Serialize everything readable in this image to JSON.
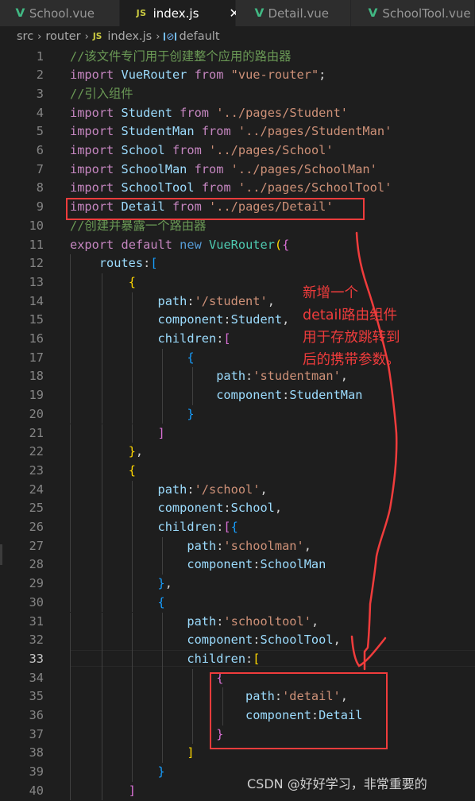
{
  "tabs": [
    {
      "label": "School.vue",
      "icon": "vue-icon",
      "active": false
    },
    {
      "label": "index.js",
      "icon": "js-icon",
      "active": true,
      "close": "✕"
    },
    {
      "label": "Detail.vue",
      "icon": "vue-icon",
      "active": false
    },
    {
      "label": "SchoolTool.vue",
      "icon": "vue-icon",
      "active": false
    }
  ],
  "icons": {
    "vue": "V",
    "js": "JS",
    "symbol": "⊘"
  },
  "breadcrumb": {
    "items": [
      "src",
      "router",
      "index.js",
      "default"
    ],
    "separator": "›"
  },
  "editor": {
    "current_line": 33,
    "lines": [
      [
        [
          "c-cmt",
          "//该文件专门用于创建整个应用的路由器"
        ]
      ],
      [
        [
          "c-kw",
          "import"
        ],
        [
          "c-pun",
          " "
        ],
        [
          "c-id",
          "VueRouter"
        ],
        [
          "c-pun",
          " "
        ],
        [
          "c-kw",
          "from"
        ],
        [
          "c-pun",
          " "
        ],
        [
          "c-str",
          "\"vue-router\""
        ],
        [
          "c-pun",
          ";"
        ]
      ],
      [
        [
          "c-cmt",
          "//引入组件"
        ]
      ],
      [
        [
          "c-kw",
          "import"
        ],
        [
          "c-pun",
          " "
        ],
        [
          "c-id",
          "Student"
        ],
        [
          "c-pun",
          " "
        ],
        [
          "c-kw",
          "from"
        ],
        [
          "c-pun",
          " "
        ],
        [
          "c-str",
          "'../pages/Student'"
        ]
      ],
      [
        [
          "c-kw",
          "import"
        ],
        [
          "c-pun",
          " "
        ],
        [
          "c-id",
          "StudentMan"
        ],
        [
          "c-pun",
          " "
        ],
        [
          "c-kw",
          "from"
        ],
        [
          "c-pun",
          " "
        ],
        [
          "c-str",
          "'../pages/StudentMan'"
        ]
      ],
      [
        [
          "c-kw",
          "import"
        ],
        [
          "c-pun",
          " "
        ],
        [
          "c-id",
          "School"
        ],
        [
          "c-pun",
          " "
        ],
        [
          "c-kw",
          "from"
        ],
        [
          "c-pun",
          " "
        ],
        [
          "c-str",
          "'../pages/School'"
        ]
      ],
      [
        [
          "c-kw",
          "import"
        ],
        [
          "c-pun",
          " "
        ],
        [
          "c-id",
          "SchoolMan"
        ],
        [
          "c-pun",
          " "
        ],
        [
          "c-kw",
          "from"
        ],
        [
          "c-pun",
          " "
        ],
        [
          "c-str",
          "'../pages/SchoolMan'"
        ]
      ],
      [
        [
          "c-kw",
          "import"
        ],
        [
          "c-pun",
          " "
        ],
        [
          "c-id",
          "SchoolTool"
        ],
        [
          "c-pun",
          " "
        ],
        [
          "c-kw",
          "from"
        ],
        [
          "c-pun",
          " "
        ],
        [
          "c-str",
          "'../pages/SchoolTool'"
        ]
      ],
      [
        [
          "c-kw",
          "import"
        ],
        [
          "c-pun",
          " "
        ],
        [
          "c-id",
          "Detail"
        ],
        [
          "c-pun",
          " "
        ],
        [
          "c-kw",
          "from"
        ],
        [
          "c-pun",
          " "
        ],
        [
          "c-str",
          "'../pages/Detail'"
        ]
      ],
      [
        [
          "c-cmt",
          "//创建并暴露一个路由器"
        ]
      ],
      [
        [
          "c-kw",
          "export"
        ],
        [
          "c-pun",
          " "
        ],
        [
          "c-kw",
          "default"
        ],
        [
          "c-pun",
          " "
        ],
        [
          "c-kw2",
          "new"
        ],
        [
          "c-pun",
          " "
        ],
        [
          "c-cls",
          "VueRouter"
        ],
        [
          "b-y",
          "("
        ],
        [
          "b-p",
          "{"
        ]
      ],
      [
        [
          "c-pun",
          "    "
        ],
        [
          "c-id",
          "routes"
        ],
        [
          "c-pun",
          ":"
        ],
        [
          "b-b",
          "["
        ]
      ],
      [
        [
          "c-pun",
          "        "
        ],
        [
          "b-y",
          "{"
        ]
      ],
      [
        [
          "c-pun",
          "            "
        ],
        [
          "c-id",
          "path"
        ],
        [
          "c-pun",
          ":"
        ],
        [
          "c-str",
          "'/student'"
        ],
        [
          "c-pun",
          ","
        ]
      ],
      [
        [
          "c-pun",
          "            "
        ],
        [
          "c-id",
          "component"
        ],
        [
          "c-pun",
          ":"
        ],
        [
          "c-id",
          "Student"
        ],
        [
          "c-pun",
          ","
        ]
      ],
      [
        [
          "c-pun",
          "            "
        ],
        [
          "c-id",
          "children"
        ],
        [
          "c-pun",
          ":"
        ],
        [
          "b-p",
          "["
        ]
      ],
      [
        [
          "c-pun",
          "                "
        ],
        [
          "b-b",
          "{"
        ]
      ],
      [
        [
          "c-pun",
          "                    "
        ],
        [
          "c-id",
          "path"
        ],
        [
          "c-pun",
          ":"
        ],
        [
          "c-str",
          "'studentman'"
        ],
        [
          "c-pun",
          ","
        ]
      ],
      [
        [
          "c-pun",
          "                    "
        ],
        [
          "c-id",
          "component"
        ],
        [
          "c-pun",
          ":"
        ],
        [
          "c-id",
          "StudentMan"
        ]
      ],
      [
        [
          "c-pun",
          "                "
        ],
        [
          "b-b",
          "}"
        ]
      ],
      [
        [
          "c-pun",
          "            "
        ],
        [
          "b-p",
          "]"
        ]
      ],
      [
        [
          "c-pun",
          "        "
        ],
        [
          "b-y",
          "}"
        ],
        [
          "c-pun",
          ","
        ]
      ],
      [
        [
          "c-pun",
          "        "
        ],
        [
          "b-y",
          "{"
        ]
      ],
      [
        [
          "c-pun",
          "            "
        ],
        [
          "c-id",
          "path"
        ],
        [
          "c-pun",
          ":"
        ],
        [
          "c-str",
          "'/school'"
        ],
        [
          "c-pun",
          ","
        ]
      ],
      [
        [
          "c-pun",
          "            "
        ],
        [
          "c-id",
          "component"
        ],
        [
          "c-pun",
          ":"
        ],
        [
          "c-id",
          "School"
        ],
        [
          "c-pun",
          ","
        ]
      ],
      [
        [
          "c-pun",
          "            "
        ],
        [
          "c-id",
          "children"
        ],
        [
          "c-pun",
          ":"
        ],
        [
          "b-p",
          "["
        ],
        [
          "b-b",
          "{"
        ]
      ],
      [
        [
          "c-pun",
          "                "
        ],
        [
          "c-id",
          "path"
        ],
        [
          "c-pun",
          ":"
        ],
        [
          "c-str",
          "'schoolman'"
        ],
        [
          "c-pun",
          ","
        ]
      ],
      [
        [
          "c-pun",
          "                "
        ],
        [
          "c-id",
          "component"
        ],
        [
          "c-pun",
          ":"
        ],
        [
          "c-id",
          "SchoolMan"
        ]
      ],
      [
        [
          "c-pun",
          "            "
        ],
        [
          "b-b",
          "}"
        ],
        [
          "c-pun",
          ","
        ]
      ],
      [
        [
          "c-pun",
          "            "
        ],
        [
          "b-b",
          "{"
        ]
      ],
      [
        [
          "c-pun",
          "                "
        ],
        [
          "c-id",
          "path"
        ],
        [
          "c-pun",
          ":"
        ],
        [
          "c-str",
          "'schooltool'"
        ],
        [
          "c-pun",
          ","
        ]
      ],
      [
        [
          "c-pun",
          "                "
        ],
        [
          "c-id",
          "component"
        ],
        [
          "c-pun",
          ":"
        ],
        [
          "c-id",
          "SchoolTool"
        ],
        [
          "c-pun",
          ","
        ]
      ],
      [
        [
          "c-pun",
          "                "
        ],
        [
          "c-id",
          "children"
        ],
        [
          "c-pun",
          ":"
        ],
        [
          "b-y",
          "["
        ]
      ],
      [
        [
          "c-pun",
          "                    "
        ],
        [
          "b-p",
          "{"
        ]
      ],
      [
        [
          "c-pun",
          "                        "
        ],
        [
          "c-id",
          "path"
        ],
        [
          "c-pun",
          ":"
        ],
        [
          "c-str",
          "'detail'"
        ],
        [
          "c-pun",
          ","
        ]
      ],
      [
        [
          "c-pun",
          "                        "
        ],
        [
          "c-id",
          "component"
        ],
        [
          "c-pun",
          ":"
        ],
        [
          "c-id",
          "Detail"
        ]
      ],
      [
        [
          "c-pun",
          "                    "
        ],
        [
          "b-p",
          "}"
        ]
      ],
      [
        [
          "c-pun",
          "                "
        ],
        [
          "b-y",
          "]"
        ]
      ],
      [
        [
          "c-pun",
          "            "
        ],
        [
          "b-b",
          "}"
        ]
      ],
      [
        [
          "c-pun",
          "        "
        ],
        [
          "b-p",
          "]"
        ]
      ]
    ]
  },
  "annotations": {
    "note_lines": [
      "新增一个",
      "detail路由组件",
      "用于存放跳转到",
      "后的携带参数。"
    ],
    "color": "#f03c3c",
    "highlighted_lines": [
      9,
      "34-37"
    ]
  },
  "watermark": "CSDN @好好学习，非常重要的"
}
